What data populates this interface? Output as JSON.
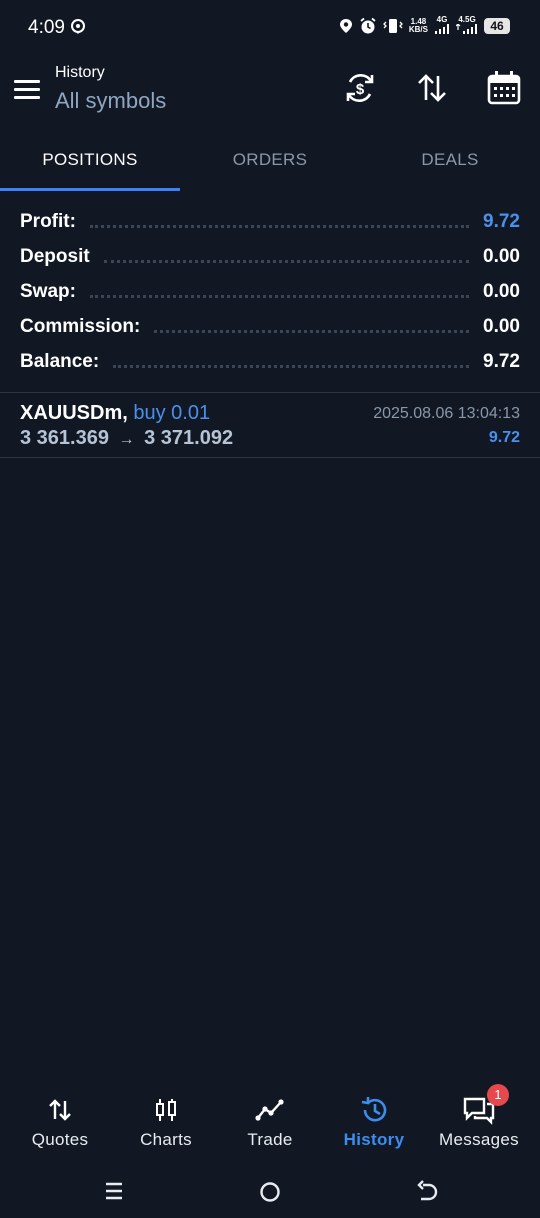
{
  "status_bar": {
    "time": "4:09",
    "speed_value": "1.48",
    "speed_unit": "KB/S",
    "net1": "4G",
    "net2": "4.5G",
    "battery": "46"
  },
  "header": {
    "title": "History",
    "subtitle": "All symbols",
    "icons": [
      "menu-icon",
      "currency-exchange-icon",
      "sort-icon",
      "calendar-icon"
    ]
  },
  "tabs": [
    {
      "label": "POSITIONS",
      "active": true
    },
    {
      "label": "ORDERS",
      "active": false
    },
    {
      "label": "DEALS",
      "active": false
    }
  ],
  "summary": [
    {
      "label": "Profit:",
      "value": "9.72",
      "highlight": true
    },
    {
      "label": "Deposit",
      "value": "0.00",
      "highlight": false
    },
    {
      "label": "Swap:",
      "value": "0.00",
      "highlight": false
    },
    {
      "label": "Commission:",
      "value": "0.00",
      "highlight": false
    },
    {
      "label": "Balance:",
      "value": "9.72",
      "highlight": false
    }
  ],
  "deals": [
    {
      "symbol": "XAUUSDm,",
      "side": "buy 0.01",
      "open_price": "3 361.369",
      "arrow": "→",
      "close_price": "3 371.092",
      "datetime": "2025.08.06 13:04:13",
      "profit": "9.72"
    }
  ],
  "bottom_nav": [
    {
      "label": "Quotes",
      "icon": "quotes-icon",
      "active": false
    },
    {
      "label": "Charts",
      "icon": "candlestick-icon",
      "active": false
    },
    {
      "label": "Trade",
      "icon": "trade-line-icon",
      "active": false
    },
    {
      "label": "History",
      "icon": "history-icon",
      "active": true
    },
    {
      "label": "Messages",
      "icon": "messages-icon",
      "active": false,
      "badge": "1"
    }
  ],
  "colors": {
    "background": "#111823",
    "accent": "#3b82f6",
    "value_blue": "#4a90ec",
    "muted": "#8a97a8",
    "badge": "#e5484d"
  }
}
